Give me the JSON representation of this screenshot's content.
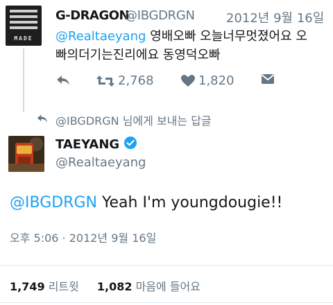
{
  "parent_tweet": {
    "display_name": "G-DRAGON",
    "handle": "@IBGDRGN",
    "date": "2012년 9월 16일",
    "mention": "@Realtaeyang",
    "text_line1": " 영배오빠 오늘너무멋졌어요 오",
    "text_line2": "빠의더기는진리에요 동영덕오빠",
    "avatar_text": "MADE",
    "retweet_count": "2,768",
    "like_count": "1,820"
  },
  "reply_context": {
    "label": "@IBGDRGN 님에게 보내는 답글"
  },
  "main_tweet": {
    "display_name": "TAEYANG",
    "handle": "@Realtaeyang",
    "mention": "@IBGDRGN",
    "text": " Yeah I'm youngdougie!!",
    "timestamp": "오후 5:06 · 2012년 9월 16일",
    "retweets_value": "1,749",
    "retweets_label": "리트윗",
    "likes_value": "1,082",
    "likes_label": "마음에 들어요"
  },
  "colors": {
    "accent": "#1da1f2",
    "secondary_text": "#657786",
    "verified": "#1da1f2"
  }
}
